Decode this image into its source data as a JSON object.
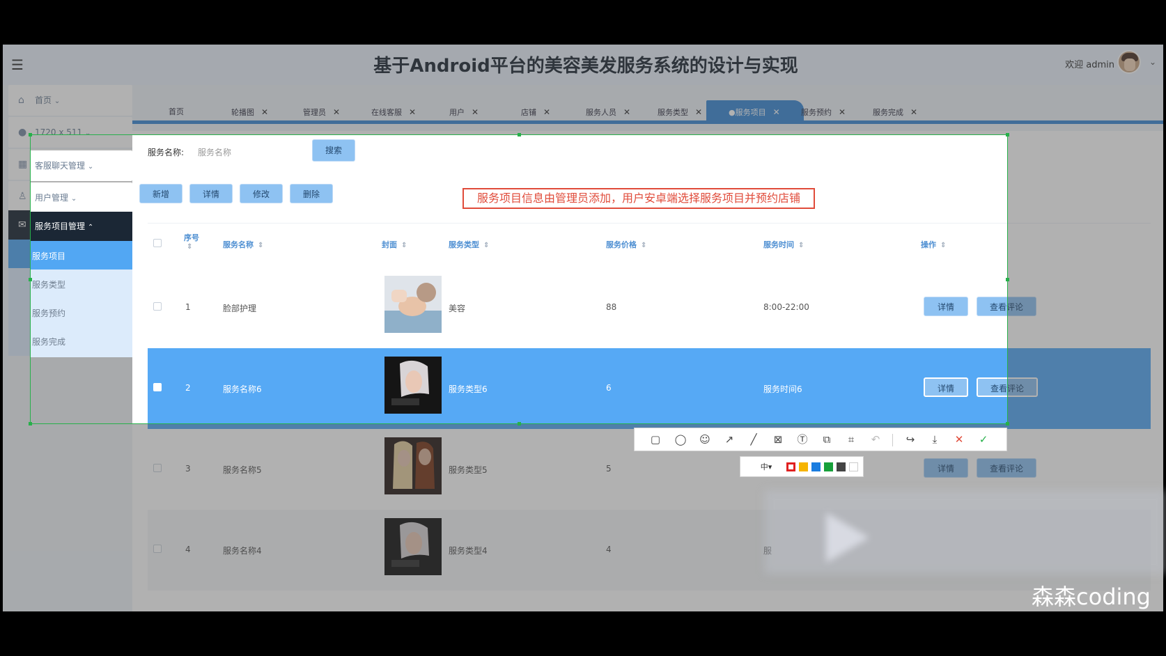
{
  "header": {
    "title": "基于Android平台的美容美发服务系统的设计与实现",
    "welcome": "欢迎 admin"
  },
  "sidebar": {
    "items": [
      {
        "label": "首页"
      },
      {
        "label": "1720 x 511"
      },
      {
        "label": "客服聊天管理"
      },
      {
        "label": "用户管理"
      }
    ],
    "group": "服务项目管理",
    "sub": [
      "服务项目",
      "服务类型",
      "服务预约",
      "服务完成"
    ]
  },
  "tabs": [
    "首页",
    "轮播图",
    "管理员",
    "在线客服",
    "用户",
    "店铺",
    "服务人员",
    "服务类型",
    "●服务项目",
    "服务预约",
    "服务完成"
  ],
  "search": {
    "label": "服务名称:",
    "placeholder": "服务名称",
    "button": "搜索"
  },
  "actions": {
    "add": "新增",
    "detail": "详情",
    "edit": "修改",
    "delete": "删除"
  },
  "annotation": "服务项目信息由管理员添加，用户安卓端选择服务项目并预约店铺",
  "table": {
    "headers": {
      "index": "序号",
      "name": "服务名称",
      "cover": "封面",
      "type": "服务类型",
      "price": "服务价格",
      "time": "服务时间",
      "ops": "操作"
    },
    "rows": [
      {
        "index": "1",
        "name": "脸部护理",
        "type": "美容",
        "price": "88",
        "time": "8:00-22:00"
      },
      {
        "index": "2",
        "name": "服务名称6",
        "type": "服务类型6",
        "price": "6",
        "time": "服务时间6"
      },
      {
        "index": "3",
        "name": "服务名称5",
        "type": "服务类型5",
        "price": "5",
        "time": ""
      },
      {
        "index": "4",
        "name": "服务名称4",
        "type": "服务类型4",
        "price": "4",
        "time": "服"
      }
    ],
    "detail_btn": "详情",
    "comments_btn": "查看评论"
  },
  "capture_toolbar": {
    "size": "中▾"
  },
  "colors": {
    "accent": "#3d8ad6",
    "selected_row": "#56a9f5",
    "annotation": "#e04b3a",
    "selection": "#27b04a"
  },
  "watermark": "森森coding"
}
